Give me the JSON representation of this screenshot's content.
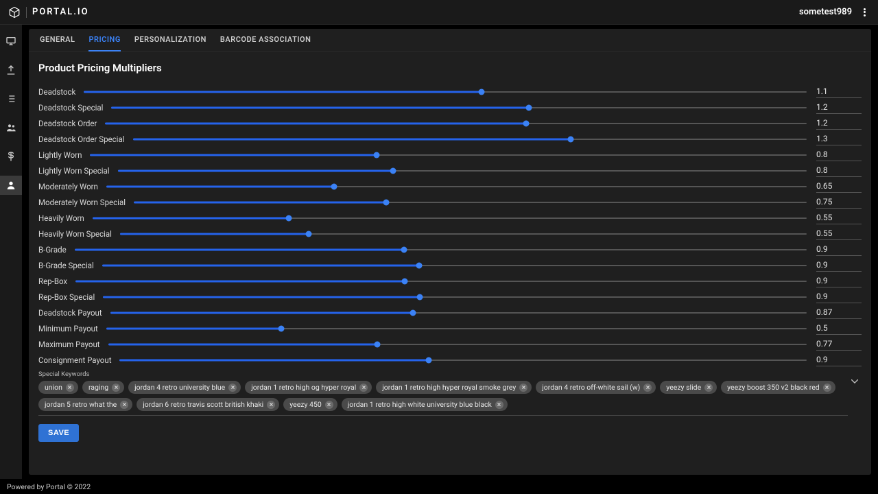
{
  "brand": {
    "name": "PORTAL.IO"
  },
  "user": {
    "name": "sometest989"
  },
  "sidebar": {
    "items": [
      {
        "name": "monitor-icon"
      },
      {
        "name": "upload-icon"
      },
      {
        "name": "list-icon"
      },
      {
        "name": "people-icon"
      },
      {
        "name": "dollar-icon"
      },
      {
        "name": "person-icon",
        "active": true
      }
    ]
  },
  "tabs": [
    {
      "label": "GENERAL",
      "active": false
    },
    {
      "label": "PRICING",
      "active": true
    },
    {
      "label": "PERSONALIZATION",
      "active": false
    },
    {
      "label": "BARCODE ASSOCIATION",
      "active": false
    }
  ],
  "panel": {
    "title": "Product Pricing Multipliers",
    "slider_min": 0,
    "slider_max": 2,
    "sliders": [
      {
        "label": "Deadstock",
        "value": "1.1"
      },
      {
        "label": "Deadstock Special",
        "value": "1.2"
      },
      {
        "label": "Deadstock Order",
        "value": "1.2"
      },
      {
        "label": "Deadstock Order Special",
        "value": "1.3"
      },
      {
        "label": "Lightly Worn",
        "value": "0.8"
      },
      {
        "label": "Lightly Worn Special",
        "value": "0.8"
      },
      {
        "label": "Moderately Worn",
        "value": "0.65"
      },
      {
        "label": "Moderately Worn Special",
        "value": "0.75"
      },
      {
        "label": "Heavily Worn",
        "value": "0.55"
      },
      {
        "label": "Heavily Worn Special",
        "value": "0.55"
      },
      {
        "label": "B-Grade",
        "value": "0.9"
      },
      {
        "label": "B-Grade Special",
        "value": "0.9"
      },
      {
        "label": "Rep-Box",
        "value": "0.9"
      },
      {
        "label": "Rep-Box Special",
        "value": "0.9"
      },
      {
        "label": "Deadstock Payout",
        "value": "0.87"
      },
      {
        "label": "Minimum Payout",
        "value": "0.5"
      },
      {
        "label": "Maximum Payout",
        "value": "0.77"
      },
      {
        "label": "Consignment Payout",
        "value": "0.9"
      }
    ],
    "keywords_label": "Special Keywords",
    "keywords": [
      "union",
      "raging",
      "jordan 4 retro university blue",
      "jordan 1 retro high og hyper royal",
      "jordan 1 retro high hyper royal smoke grey",
      "jordan 4 retro off-white sail (w)",
      "yeezy slide",
      "yeezy boost 350 v2 black red",
      "jordan 5 retro what the",
      "jordan 6 retro travis scott british khaki",
      "yeezy 450",
      "jordan 1 retro high white university blue black"
    ],
    "save_label": "SAVE"
  },
  "footer": {
    "text": "Powered by Portal © 2022"
  }
}
